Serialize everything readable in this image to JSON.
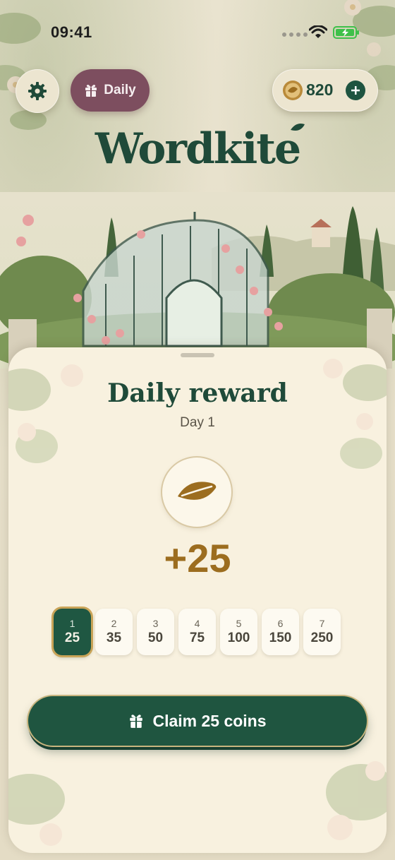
{
  "status_bar": {
    "time": "09:41"
  },
  "header": {
    "daily_label": "Daily",
    "coins": "820",
    "logo": "Wordkite"
  },
  "reward": {
    "title": "Daily reward",
    "day_label": "Day 1",
    "amount": "+25",
    "days": [
      {
        "day": "1",
        "value": "25",
        "active": true
      },
      {
        "day": "2",
        "value": "35",
        "active": false
      },
      {
        "day": "3",
        "value": "50",
        "active": false
      },
      {
        "day": "4",
        "value": "75",
        "active": false
      },
      {
        "day": "5",
        "value": "100",
        "active": false
      },
      {
        "day": "6",
        "value": "150",
        "active": false
      },
      {
        "day": "7",
        "value": "250",
        "active": false
      }
    ],
    "claim_label": "Claim 25 coins"
  },
  "icons": {
    "settings": "gear-icon",
    "daily": "gift-icon",
    "coin": "coin-icon",
    "add": "plus-icon",
    "reward": "leaf-icon",
    "claim": "gift-icon"
  },
  "colors": {
    "brand_green": "#1f5540",
    "daily_pill": "#7d4e5f",
    "reward_gold": "#9c6d1f",
    "sheet_bg": "#f8f1df"
  }
}
